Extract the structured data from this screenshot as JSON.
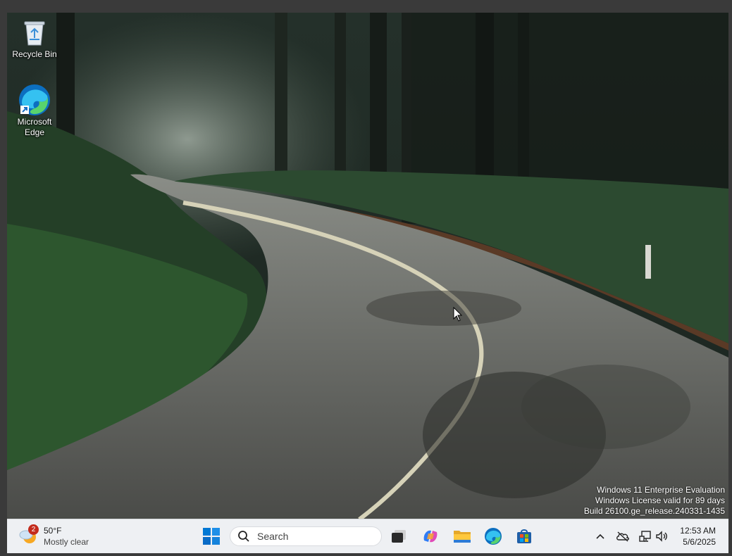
{
  "desktop": {
    "icons": [
      {
        "label": "Recycle Bin",
        "icon": "recycle-bin-icon"
      },
      {
        "label": "Microsoft Edge",
        "icon": "edge-icon"
      }
    ],
    "watermark": [
      "Windows 11 Enterprise Evaluation",
      "Windows License valid for 89 days",
      "Build 26100.ge_release.240331-1435"
    ]
  },
  "taskbar": {
    "weather": {
      "temp": "50°F",
      "condition": "Mostly clear",
      "badge": "2",
      "icon": "weather-cloud-sun-icon"
    },
    "start_icon": "windows-start-icon",
    "search": {
      "placeholder": "Search",
      "value": ""
    },
    "apps": [
      {
        "name": "task-view",
        "icon": "task-view-icon"
      },
      {
        "name": "copilot",
        "icon": "copilot-icon"
      },
      {
        "name": "file-explorer",
        "icon": "folder-icon"
      },
      {
        "name": "edge",
        "icon": "edge-icon"
      },
      {
        "name": "store",
        "icon": "store-icon"
      }
    ],
    "tray": [
      "chevron-up-icon",
      "onedrive-offline-icon",
      "network-icon",
      "volume-icon"
    ],
    "clock": {
      "time": "12:53 AM",
      "date": "5/6/2025"
    }
  },
  "colors": {
    "taskbar": "#eef0f3",
    "start_blue": "#0078d4",
    "badge": "#c42b1c"
  }
}
